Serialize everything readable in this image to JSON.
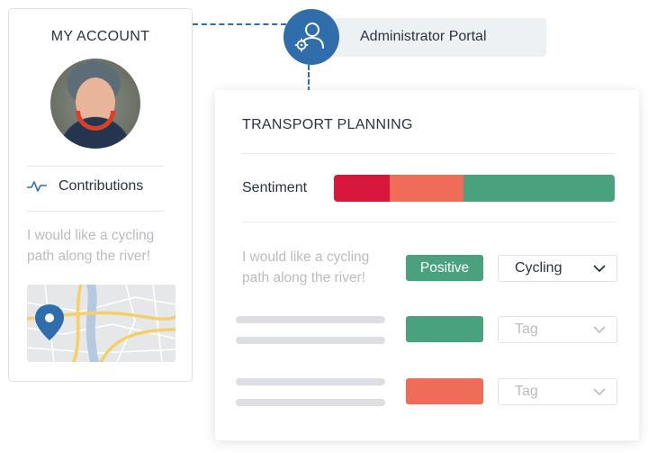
{
  "account": {
    "title": "MY ACCOUNT",
    "nav_item": "Contributions",
    "comment": "I would like a cycling path along the river!"
  },
  "portal": {
    "label": "Administrator Portal"
  },
  "planning": {
    "title": "TRANSPORT PLANNING",
    "sentiment_label": "Sentiment",
    "sentiment_segments": [
      {
        "color": "#d7173b",
        "fraction": 0.2
      },
      {
        "color": "#ef6c58",
        "fraction": 0.26
      },
      {
        "color": "#4aa17d",
        "fraction": 0.54
      }
    ],
    "rows": [
      {
        "comment": "I would like a cycling path along the river!",
        "sentiment": "Positive",
        "sentiment_color": "#4aa17d",
        "tag": "Cycling",
        "tag_is_placeholder": false
      },
      {
        "comment": "",
        "sentiment": "",
        "sentiment_color": "#4aa17d",
        "tag": "Tag",
        "tag_is_placeholder": true
      },
      {
        "comment": "",
        "sentiment": "",
        "sentiment_color": "#ef6c58",
        "tag": "Tag",
        "tag_is_placeholder": true
      }
    ]
  },
  "icons": {
    "contributions": "pulse-icon",
    "portal": "user-gear-icon",
    "map_pin": "map-pin-icon",
    "dropdown": "chevron-down-icon"
  },
  "colors": {
    "accent": "#2f6eab",
    "positive": "#4aa17d",
    "negative": "#d7173b",
    "neutral_negative": "#ef6c58"
  }
}
